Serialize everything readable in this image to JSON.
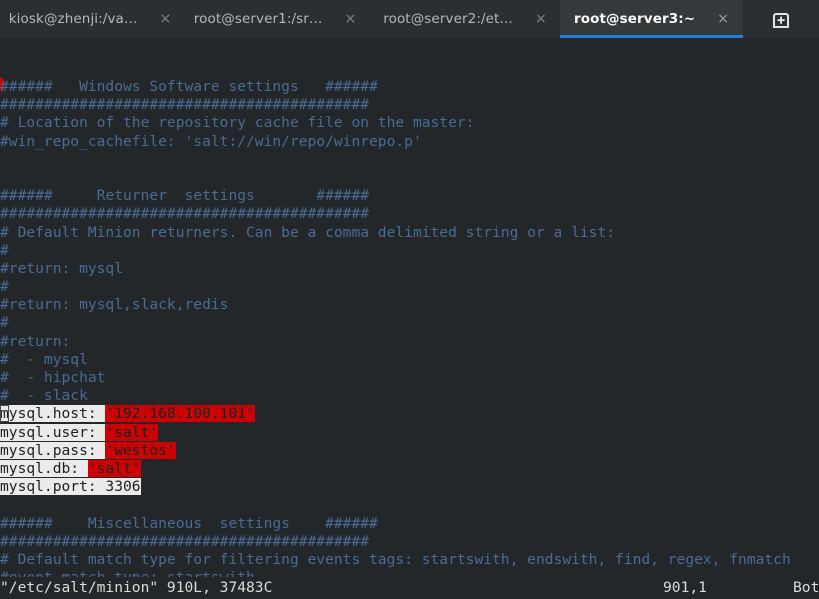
{
  "window": {
    "title": "root@server3:~",
    "accent_color": "#1f7fd4",
    "tabbar_bg": "#2b2f31",
    "terminal_bg": "#232729",
    "comment_color": "#4a6b95",
    "highlight_color": "#cc0000",
    "selection_color": "#ebebeb"
  },
  "tabbar": {
    "tabs": [
      {
        "label": "kiosk@zhenji:/va…",
        "close": "×",
        "active": false,
        "name": "tab-kiosk-zhenji"
      },
      {
        "label": "root@server1:/sr…",
        "close": "×",
        "active": false,
        "name": "tab-root-server1"
      },
      {
        "label": "root@server2:/et…",
        "close": "×",
        "active": false,
        "name": "tab-root-server2"
      },
      {
        "label": "root@server3:~",
        "close": "×",
        "active": true,
        "name": "tab-root-server3"
      }
    ],
    "new_tab_icon": "new-tab-icon",
    "new_tab_tooltip": "New Tab"
  },
  "editor": {
    "app": "vim",
    "file": "/etc/salt/minion",
    "lines": [
      "######   Windows Software settings   ######",
      "##########################################",
      "# Location of the repository cache file on the master:",
      "#win_repo_cachefile: 'salt://win/repo/winrepo.p'",
      "",
      "",
      "######     Returner  settings       ######",
      "##########################################",
      "# Default Minion returners. Can be a comma delimited string or a list:",
      "#",
      "#return: mysql",
      "#",
      "#return: mysql,slack,redis",
      "#",
      "#return:",
      "#  - mysql",
      "#  - hipchat",
      "#  - slack"
    ],
    "config_block": [
      {
        "key": "mysql.host: ",
        "value": "'192.168.100.101'",
        "highlighted": true
      },
      {
        "key": "mysql.user: ",
        "value": "'salt'",
        "highlighted": true
      },
      {
        "key": "mysql.pass: ",
        "value": "'westos'",
        "highlighted": true
      },
      {
        "key": "mysql.db: ",
        "value": "'salt'",
        "highlighted": true
      },
      {
        "key": "mysql.port: 3306",
        "value": "",
        "highlighted": false
      }
    ],
    "cursor_char": "m",
    "trailing_lines": [
      "",
      "######    Miscellaneous  settings    ######",
      "##########################################",
      "# Default match type for filtering events tags: startswith, endswith, find, regex, fnmatch",
      "#event_match_type: startswith"
    ]
  },
  "statusline": {
    "file_info": "\"/etc/salt/minion\" 910L, 37483C",
    "position": "901,1",
    "state": "Bot"
  }
}
